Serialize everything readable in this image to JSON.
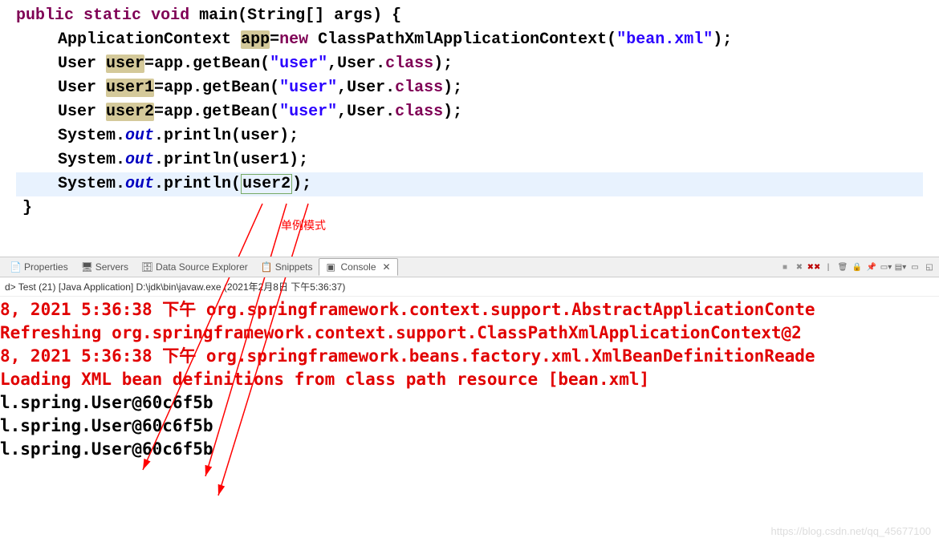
{
  "editor": {
    "lines": {
      "l1": {
        "kw1": "public",
        "kw2": "static",
        "kw3": "void",
        "method": "main",
        "paren": "(String[] args) {"
      },
      "l2": {
        "type": "ApplicationContext",
        "var": "app",
        "eq": "=",
        "kw_new": "new",
        "ctor": "ClassPathXmlApplicationContext(",
        "str": "\"bean.xml\"",
        "end": ");"
      },
      "l3": {
        "type": "User",
        "var": "user",
        "eq": "=",
        "obj": "app",
        "dot1": ".getBean(",
        "str": "\"user\"",
        "mid": ",User.",
        "kw_class": "class",
        "end": ");"
      },
      "l4": {
        "type": "User",
        "var": "user1",
        "eq": "=",
        "obj": "app",
        "dot1": ".getBean(",
        "str": "\"user\"",
        "mid": ",User.",
        "kw_class": "class",
        "end": ");"
      },
      "l5": {
        "type": "User",
        "var": "user2",
        "eq": "=",
        "obj": "app",
        "dot1": ".getBean(",
        "str": "\"user\"",
        "mid": ",User.",
        "kw_class": "class",
        "end": ");"
      },
      "l6": {
        "sys": "System.",
        "out": "out",
        "call": ".println(",
        "arg": "user",
        "end": ");"
      },
      "l7": {
        "sys": "System.",
        "out": "out",
        "call": ".println(",
        "arg": "user1",
        "end": ");"
      },
      "l8": {
        "sys": "System.",
        "out": "out",
        "call": ".println(",
        "arg": "user2",
        "end": ");"
      },
      "l9": "}"
    },
    "annotation": "单例模式"
  },
  "tabs": {
    "properties": "Properties",
    "servers": "Servers",
    "dse": "Data Source Explorer",
    "snippets": "Snippets",
    "console": "Console"
  },
  "run_info": "d> Test (21) [Java Application] D:\\jdk\\bin\\javaw.exe (2021年2月8日 下午5:36:37)",
  "console": {
    "l1": "8, 2021 5:36:38 下午 org.springframework.context.support.AbstractApplicationConte",
    "l2": "Refreshing org.springframework.context.support.ClassPathXmlApplicationContext@2",
    "l3": "8, 2021 5:36:38 下午 org.springframework.beans.factory.xml.XmlBeanDefinitionReade",
    "l4": "Loading XML bean definitions from class path resource [bean.xml]",
    "l5": "l.spring.User@60c6f5b",
    "l6": "l.spring.User@60c6f5b",
    "l7": "l.spring.User@60c6f5b"
  },
  "watermark": "https://blog.csdn.net/qq_45677100"
}
